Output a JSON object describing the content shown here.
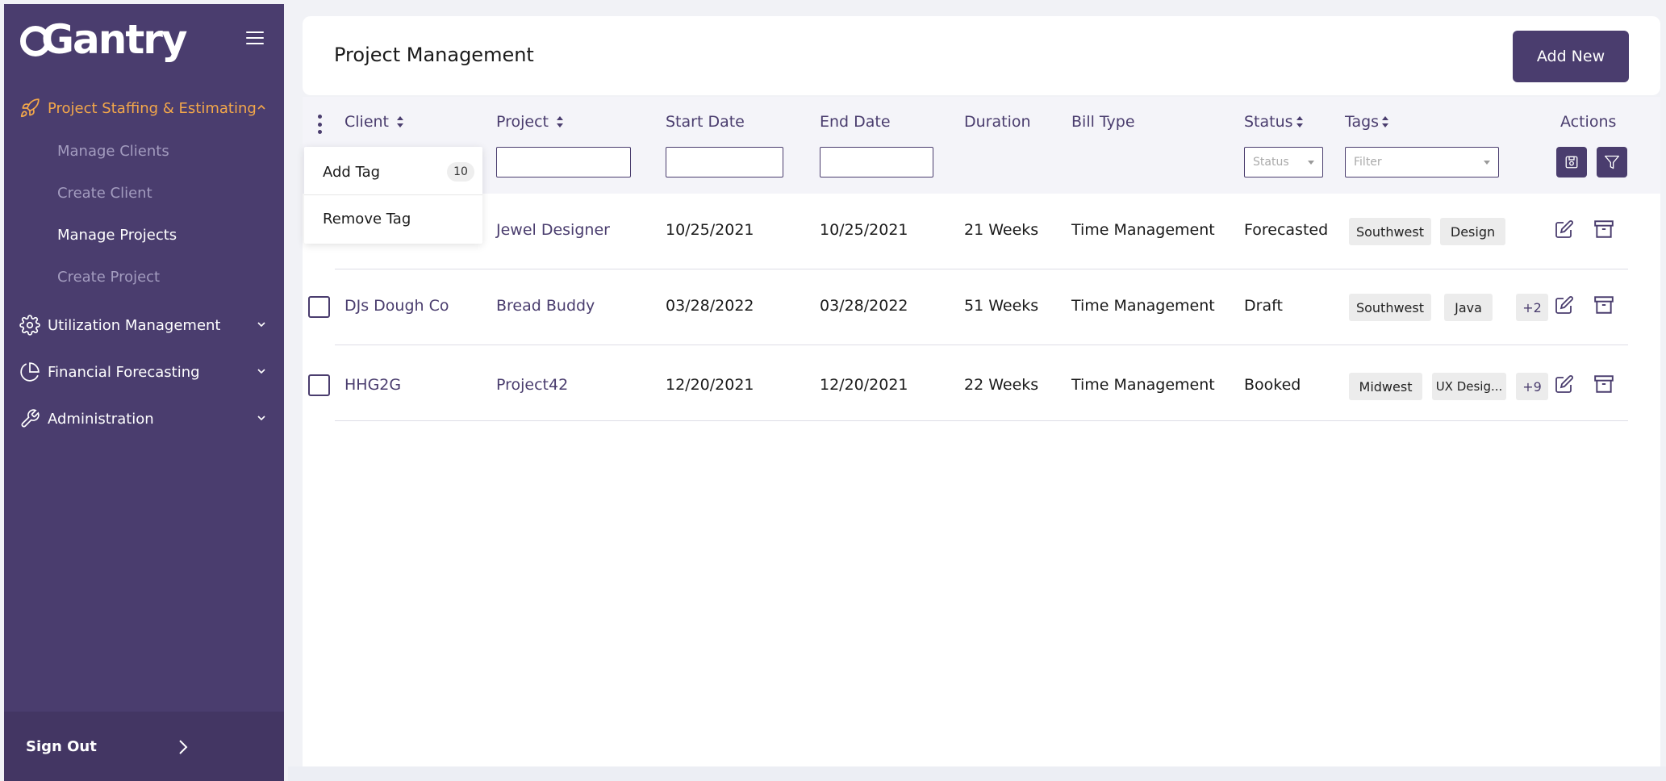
{
  "brand": {
    "logo_text": "Gantry"
  },
  "sidebar": {
    "sections": [
      {
        "label": "Project Staffing & Estimating",
        "icon": "rocket-icon",
        "expanded": true
      },
      {
        "label": "Utilization Management",
        "icon": "gear-icon",
        "expanded": false
      },
      {
        "label": "Financial Forecasting",
        "icon": "pie-chart-icon",
        "expanded": false
      },
      {
        "label": "Administration",
        "icon": "wrench-icon",
        "expanded": false
      }
    ],
    "sub_items": [
      {
        "label": "Manage Clients"
      },
      {
        "label": "Create Client"
      },
      {
        "label": "Manage Projects"
      },
      {
        "label": "Create Project"
      }
    ],
    "sign_out": "Sign Out",
    "accent_color": "#f3a74a",
    "bg_color": "#4a3d6e"
  },
  "header": {
    "title": "Project Management",
    "add_new": "Add New"
  },
  "table": {
    "columns": {
      "client": "Client",
      "project": "Project",
      "start_date": "Start Date",
      "end_date": "End Date",
      "duration": "Duration",
      "bill_type": "Bill Type",
      "status": "Status",
      "tags": "Tags",
      "actions": "Actions"
    },
    "filters": {
      "status_placeholder": "Status",
      "tags_placeholder": "Filter"
    },
    "rows": [
      {
        "client": "",
        "project": "Jewel Designer",
        "start_date": "10/25/2021",
        "end_date": "10/25/2021",
        "duration": "21 Weeks",
        "bill_type": "Time Management",
        "status": "Forecasted",
        "tags": [
          "Southwest",
          "Design"
        ],
        "more": ""
      },
      {
        "client": "DJs Dough Co",
        "project": "Bread Buddy",
        "start_date": "03/28/2022",
        "end_date": "03/28/2022",
        "duration": "51 Weeks",
        "bill_type": "Time Management",
        "status": "Draft",
        "tags": [
          "Southwest",
          "Java"
        ],
        "more": "+2"
      },
      {
        "client": "HHG2G",
        "project": "Project42",
        "start_date": "12/20/2021",
        "end_date": "12/20/2021",
        "duration": "22 Weeks",
        "bill_type": "Time Management",
        "status": "Booked",
        "tags": [
          "Midwest",
          "UX Desig..."
        ],
        "more": "+9"
      }
    ]
  },
  "bulk_menu": {
    "add_tag": "Add Tag",
    "add_tag_count": "10",
    "remove_tag": "Remove Tag"
  }
}
